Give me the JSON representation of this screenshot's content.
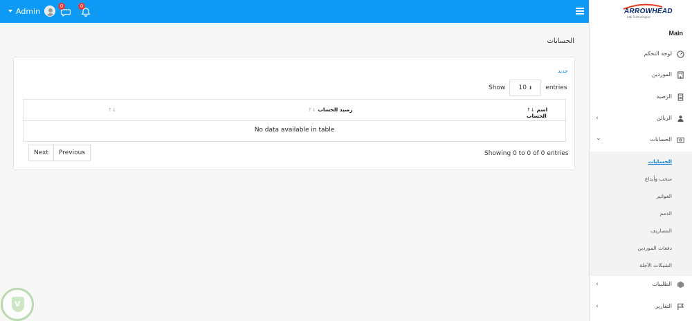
{
  "header": {
    "user_label": "Admin",
    "messages_badge": "0",
    "notifications_badge": "0",
    "logo_text": "ARROWHEAD",
    "logo_subtitle": "Lab Technologies"
  },
  "sidebar": {
    "section_label": "Main",
    "items": [
      {
        "label": "لوحة التحكم",
        "icon": "dashboard-icon"
      },
      {
        "label": "الموردين",
        "icon": "suppliers-icon"
      },
      {
        "label": "الرصيد",
        "icon": "balance-icon"
      },
      {
        "label": "الزبائن",
        "icon": "customer-icon"
      },
      {
        "label": "الحسابات",
        "icon": "accounts-icon"
      },
      {
        "label": "الطلبيات",
        "icon": "orders-icon"
      },
      {
        "label": "التقارير",
        "icon": "flag-icon"
      }
    ],
    "submenu": [
      {
        "label": "الحسابات",
        "active": true
      },
      {
        "label": "سحب وأيداع"
      },
      {
        "label": "الفواتير"
      },
      {
        "label": "الذمم"
      },
      {
        "label": "المصاريف"
      },
      {
        "label": "دفعات الموردين"
      },
      {
        "label": "الشيكات الآجلة"
      }
    ]
  },
  "main": {
    "page_title": "الحسابات",
    "new_link": "جديد",
    "show_label": "Show",
    "entries_label": "entries",
    "page_size": "10",
    "table": {
      "columns": [
        "اسم الحساب",
        "رصيد الحساب",
        ""
      ],
      "empty_message": "No data available in table"
    },
    "info": "Showing 0 to 0 of 0 entries",
    "pagination": {
      "next": "Next",
      "previous": "Previous"
    }
  },
  "colors": {
    "topbar": "#0d9af5",
    "link": "#0d7fd4",
    "badge": "#e53935"
  }
}
